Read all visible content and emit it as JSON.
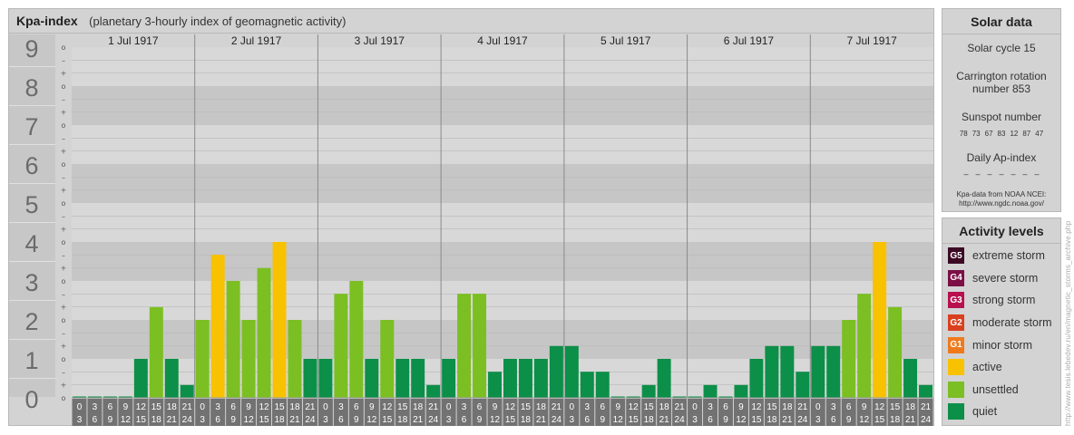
{
  "header": {
    "title": "Kpa-index",
    "subtitle": "(planetary 3-hourly index of geomagnetic activity)"
  },
  "chart_data": {
    "type": "bar",
    "title": "Kpa-index",
    "subtitle": "(planetary 3-hourly index of geomagnetic activity)",
    "ylim": [
      0,
      9
    ],
    "y_ticks": [
      "0",
      "1",
      "2",
      "3",
      "4",
      "5",
      "6",
      "7",
      "8",
      "9"
    ],
    "sub_ticks": [
      "+",
      "–",
      "o"
    ],
    "days": [
      "1 Jul 1917",
      "2 Jul 1917",
      "3 Jul 1917",
      "4 Jul 1917",
      "5 Jul 1917",
      "6 Jul 1917",
      "7 Jul 1917"
    ],
    "hour_ranges": [
      [
        "0",
        "3"
      ],
      [
        "3",
        "6"
      ],
      [
        "6",
        "9"
      ],
      [
        "9",
        "12"
      ],
      [
        "12",
        "15"
      ],
      [
        "15",
        "18"
      ],
      [
        "18",
        "21"
      ],
      [
        "21",
        "24"
      ]
    ],
    "values": [
      [
        0,
        0,
        0,
        0,
        1,
        2.33,
        1,
        0.33
      ],
      [
        2,
        3.67,
        3,
        2,
        3.33,
        4,
        2,
        1
      ],
      [
        1,
        2.67,
        3,
        1,
        2,
        1,
        1,
        0.33
      ],
      [
        1,
        2.67,
        2.67,
        0.67,
        1,
        1,
        1,
        1.33
      ],
      [
        1.33,
        0.67,
        0.67,
        0,
        0,
        0.33,
        1,
        0
      ],
      [
        0,
        0.33,
        0,
        0.33,
        1,
        1.33,
        1.33,
        0.67
      ],
      [
        1.33,
        1.33,
        2,
        2.67,
        4,
        2.33,
        1,
        0.33
      ]
    ],
    "colors": {
      "quiet": "#0c8f48",
      "unsettled": "#7bbf22",
      "active": "#f8c200",
      "minor_storm": "#ef7a1d",
      "moderate_storm": "#d9401e",
      "strong_storm": "#b8104f",
      "severe_storm": "#7c0f45",
      "extreme_storm": "#3d0a24"
    }
  },
  "solar": {
    "title": "Solar data",
    "cycle": "Solar cycle 15",
    "carrington_line1": "Carrington rotation",
    "carrington_line2": "number 853",
    "sunspot_label": "Sunspot number",
    "sunspots": [
      "78",
      "73",
      "67",
      "83",
      "12",
      "87",
      "47"
    ],
    "ap_label": "Daily Ap-index",
    "ap_values": [
      "–",
      "–",
      "–",
      "–",
      "–",
      "–",
      "–"
    ],
    "source_line1": "Kpa-data from NOAA NCEI:",
    "source_line2": "http://www.ngdc.noaa.gov/"
  },
  "activity": {
    "title": "Activity levels",
    "levels": [
      {
        "code": "G5",
        "label": "extreme storm",
        "color": "#3d0a24"
      },
      {
        "code": "G4",
        "label": "severe storm",
        "color": "#7c0f45"
      },
      {
        "code": "G3",
        "label": "strong storm",
        "color": "#b8104f"
      },
      {
        "code": "G2",
        "label": "moderate storm",
        "color": "#d9401e"
      },
      {
        "code": "G1",
        "label": "minor storm",
        "color": "#ef7a1d"
      },
      {
        "code": "",
        "label": "active",
        "color": "#f8c200"
      },
      {
        "code": "",
        "label": "unsettled",
        "color": "#7bbf22"
      },
      {
        "code": "",
        "label": "quiet",
        "color": "#0c8f48"
      }
    ]
  },
  "watermark": "http://www.tesis.lebedev.ru/en/magnetic_storms_archive.php"
}
